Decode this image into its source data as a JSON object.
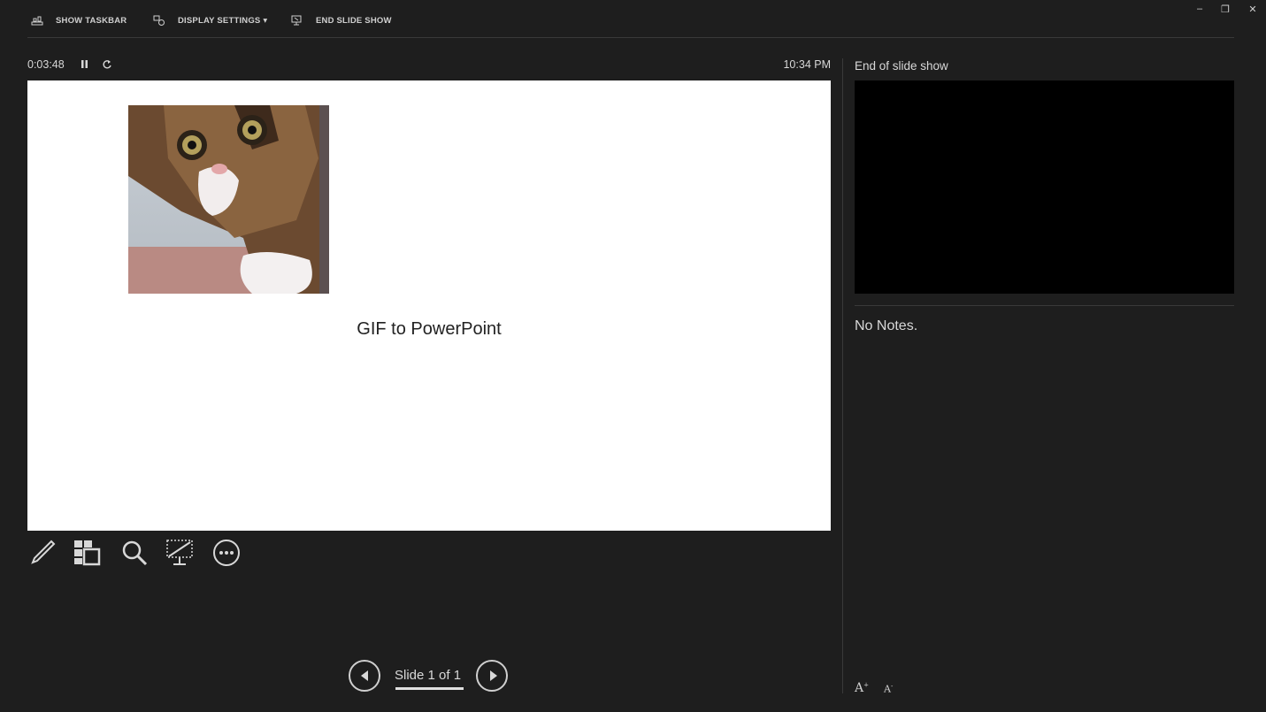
{
  "toolbar": {
    "show_taskbar": "SHOW TASKBAR",
    "display_settings": "DISPLAY SETTINGS ▾",
    "end_slide_show": "END SLIDE SHOW"
  },
  "window_controls": {
    "minimize": "–",
    "restore": "❐",
    "close": "✕"
  },
  "presenter": {
    "timer": "0:03:48",
    "clock": "10:34 PM",
    "next_slide_label": "End of slide show",
    "notes": "No Notes."
  },
  "slide": {
    "caption": "GIF to PowerPoint"
  },
  "navigation": {
    "slide_counter": "Slide 1 of 1"
  },
  "notes_font": {
    "increase": "A",
    "decrease": "A"
  },
  "colors": {
    "background": "#1e1e1e",
    "text": "#d8d8d8",
    "slide_background": "#ffffff",
    "preview_background": "#000000"
  }
}
